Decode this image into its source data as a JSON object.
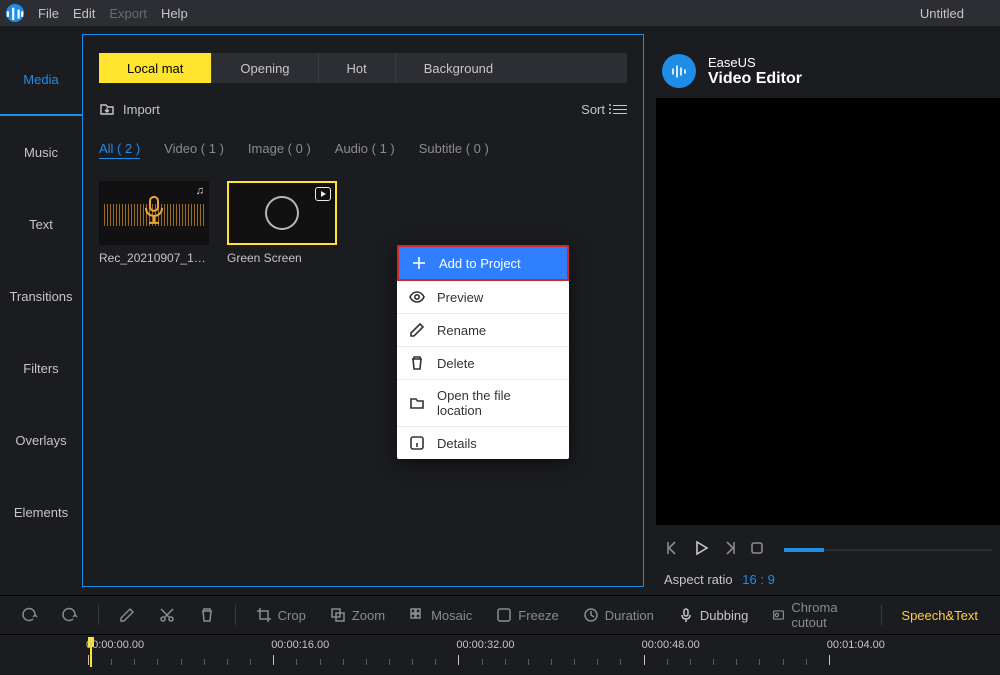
{
  "menu": {
    "file": "File",
    "edit": "Edit",
    "export": "Export",
    "help": "Help"
  },
  "document_title": "Untitled",
  "sidebar": [
    "Media",
    "Music",
    "Text",
    "Transitions",
    "Filters",
    "Overlays",
    "Elements"
  ],
  "tabs": [
    "Local mat",
    "Opening",
    "Hot",
    "Background"
  ],
  "import_label": "Import",
  "sort_label": "Sort",
  "filters": [
    {
      "label": "All ( 2 )",
      "active": true
    },
    {
      "label": "Video ( 1 )"
    },
    {
      "label": "Image ( 0 )"
    },
    {
      "label": "Audio ( 1 )"
    },
    {
      "label": "Subtitle ( 0 )"
    }
  ],
  "thumbs": [
    {
      "name": "Rec_20210907_1635...",
      "kind": "audio"
    },
    {
      "name": "Green Screen",
      "kind": "video",
      "selected": true
    }
  ],
  "context_menu": [
    {
      "label": "Add to Project",
      "icon": "plus",
      "highlight": true
    },
    {
      "label": "Preview",
      "icon": "eye"
    },
    {
      "label": "Rename",
      "icon": "pencil"
    },
    {
      "label": "Delete",
      "icon": "trash"
    },
    {
      "label": "Open the file location",
      "icon": "folder"
    },
    {
      "label": "Details",
      "icon": "info"
    }
  ],
  "brand": {
    "l1": "EaseUS",
    "l2": "Video Editor"
  },
  "aspect_ratio": {
    "label": "Aspect ratio",
    "value": "16 : 9"
  },
  "toolbar": {
    "crop": "Crop",
    "zoom": "Zoom",
    "mosaic": "Mosaic",
    "freeze": "Freeze",
    "duration": "Duration",
    "dubbing": "Dubbing",
    "chroma": "Chroma cutout",
    "speech": "Speech&Text"
  },
  "timeline_marks": [
    "00:00:00.00",
    "00:00:16.00",
    "00:00:32.00",
    "00:00:48.00",
    "00:01:04.00"
  ]
}
